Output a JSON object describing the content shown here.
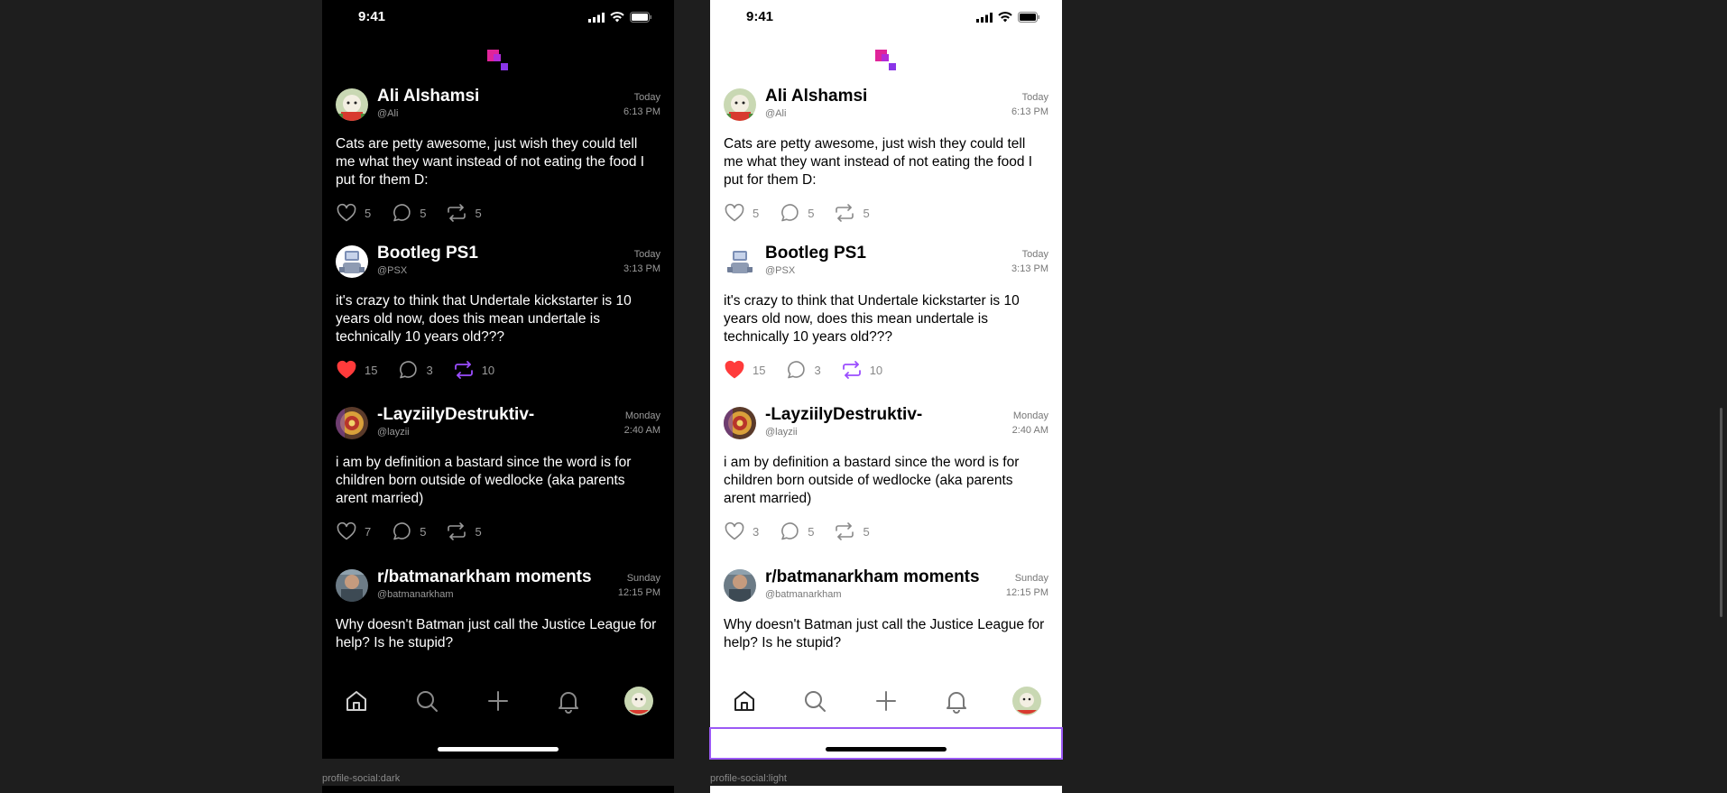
{
  "frames": {
    "dark": {
      "label": "profile-social:dark"
    },
    "light": {
      "label": "profile-social:light"
    }
  },
  "status": {
    "time": "9:41"
  },
  "colors": {
    "like": "#ff3b3b",
    "repost": "#9b4dff",
    "accent": "#e0249a",
    "selection": "#9b59f5"
  },
  "posts": [
    {
      "name": "Ali Alshamsi",
      "handle": "@Ali",
      "date": "Today",
      "time": "6:13 PM",
      "text": "Cats are petty awesome, just wish they could tell me what they want instead of not eating the food I put for them D:",
      "likes": "5",
      "comments": "5",
      "reposts": "5",
      "liked": false,
      "reposted": false
    },
    {
      "name": "Bootleg PS1",
      "handle": "@PSX",
      "date": "Today",
      "time": "3:13 PM",
      "text": "it's crazy to think that Undertale kickstarter is 10 years old now, does this mean undertale is technically 10 years old???",
      "likes": "15",
      "comments": "3",
      "reposts": "10",
      "liked": true,
      "reposted": true
    },
    {
      "name": "-LayziilyDestruktiv-",
      "handle": "@layzii",
      "date": "Monday",
      "time": "2:40 AM",
      "text": "i am by definition a bastard since the word is for children born outside of wedlocke (aka parents arent married)",
      "likes_dark": "7",
      "likes_light": "3",
      "comments": "5",
      "reposts": "5",
      "liked": false,
      "reposted": false
    },
    {
      "name": "r/batmanarkham moments",
      "handle": "@batmanarkham",
      "date": "Sunday",
      "time": "12:15 PM",
      "text": "Why doesn't Batman just call the Justice League for help? Is he stupid?"
    }
  ],
  "tabs": [
    "home-icon",
    "search-icon",
    "plus-icon",
    "bell-icon",
    "profile-avatar"
  ]
}
